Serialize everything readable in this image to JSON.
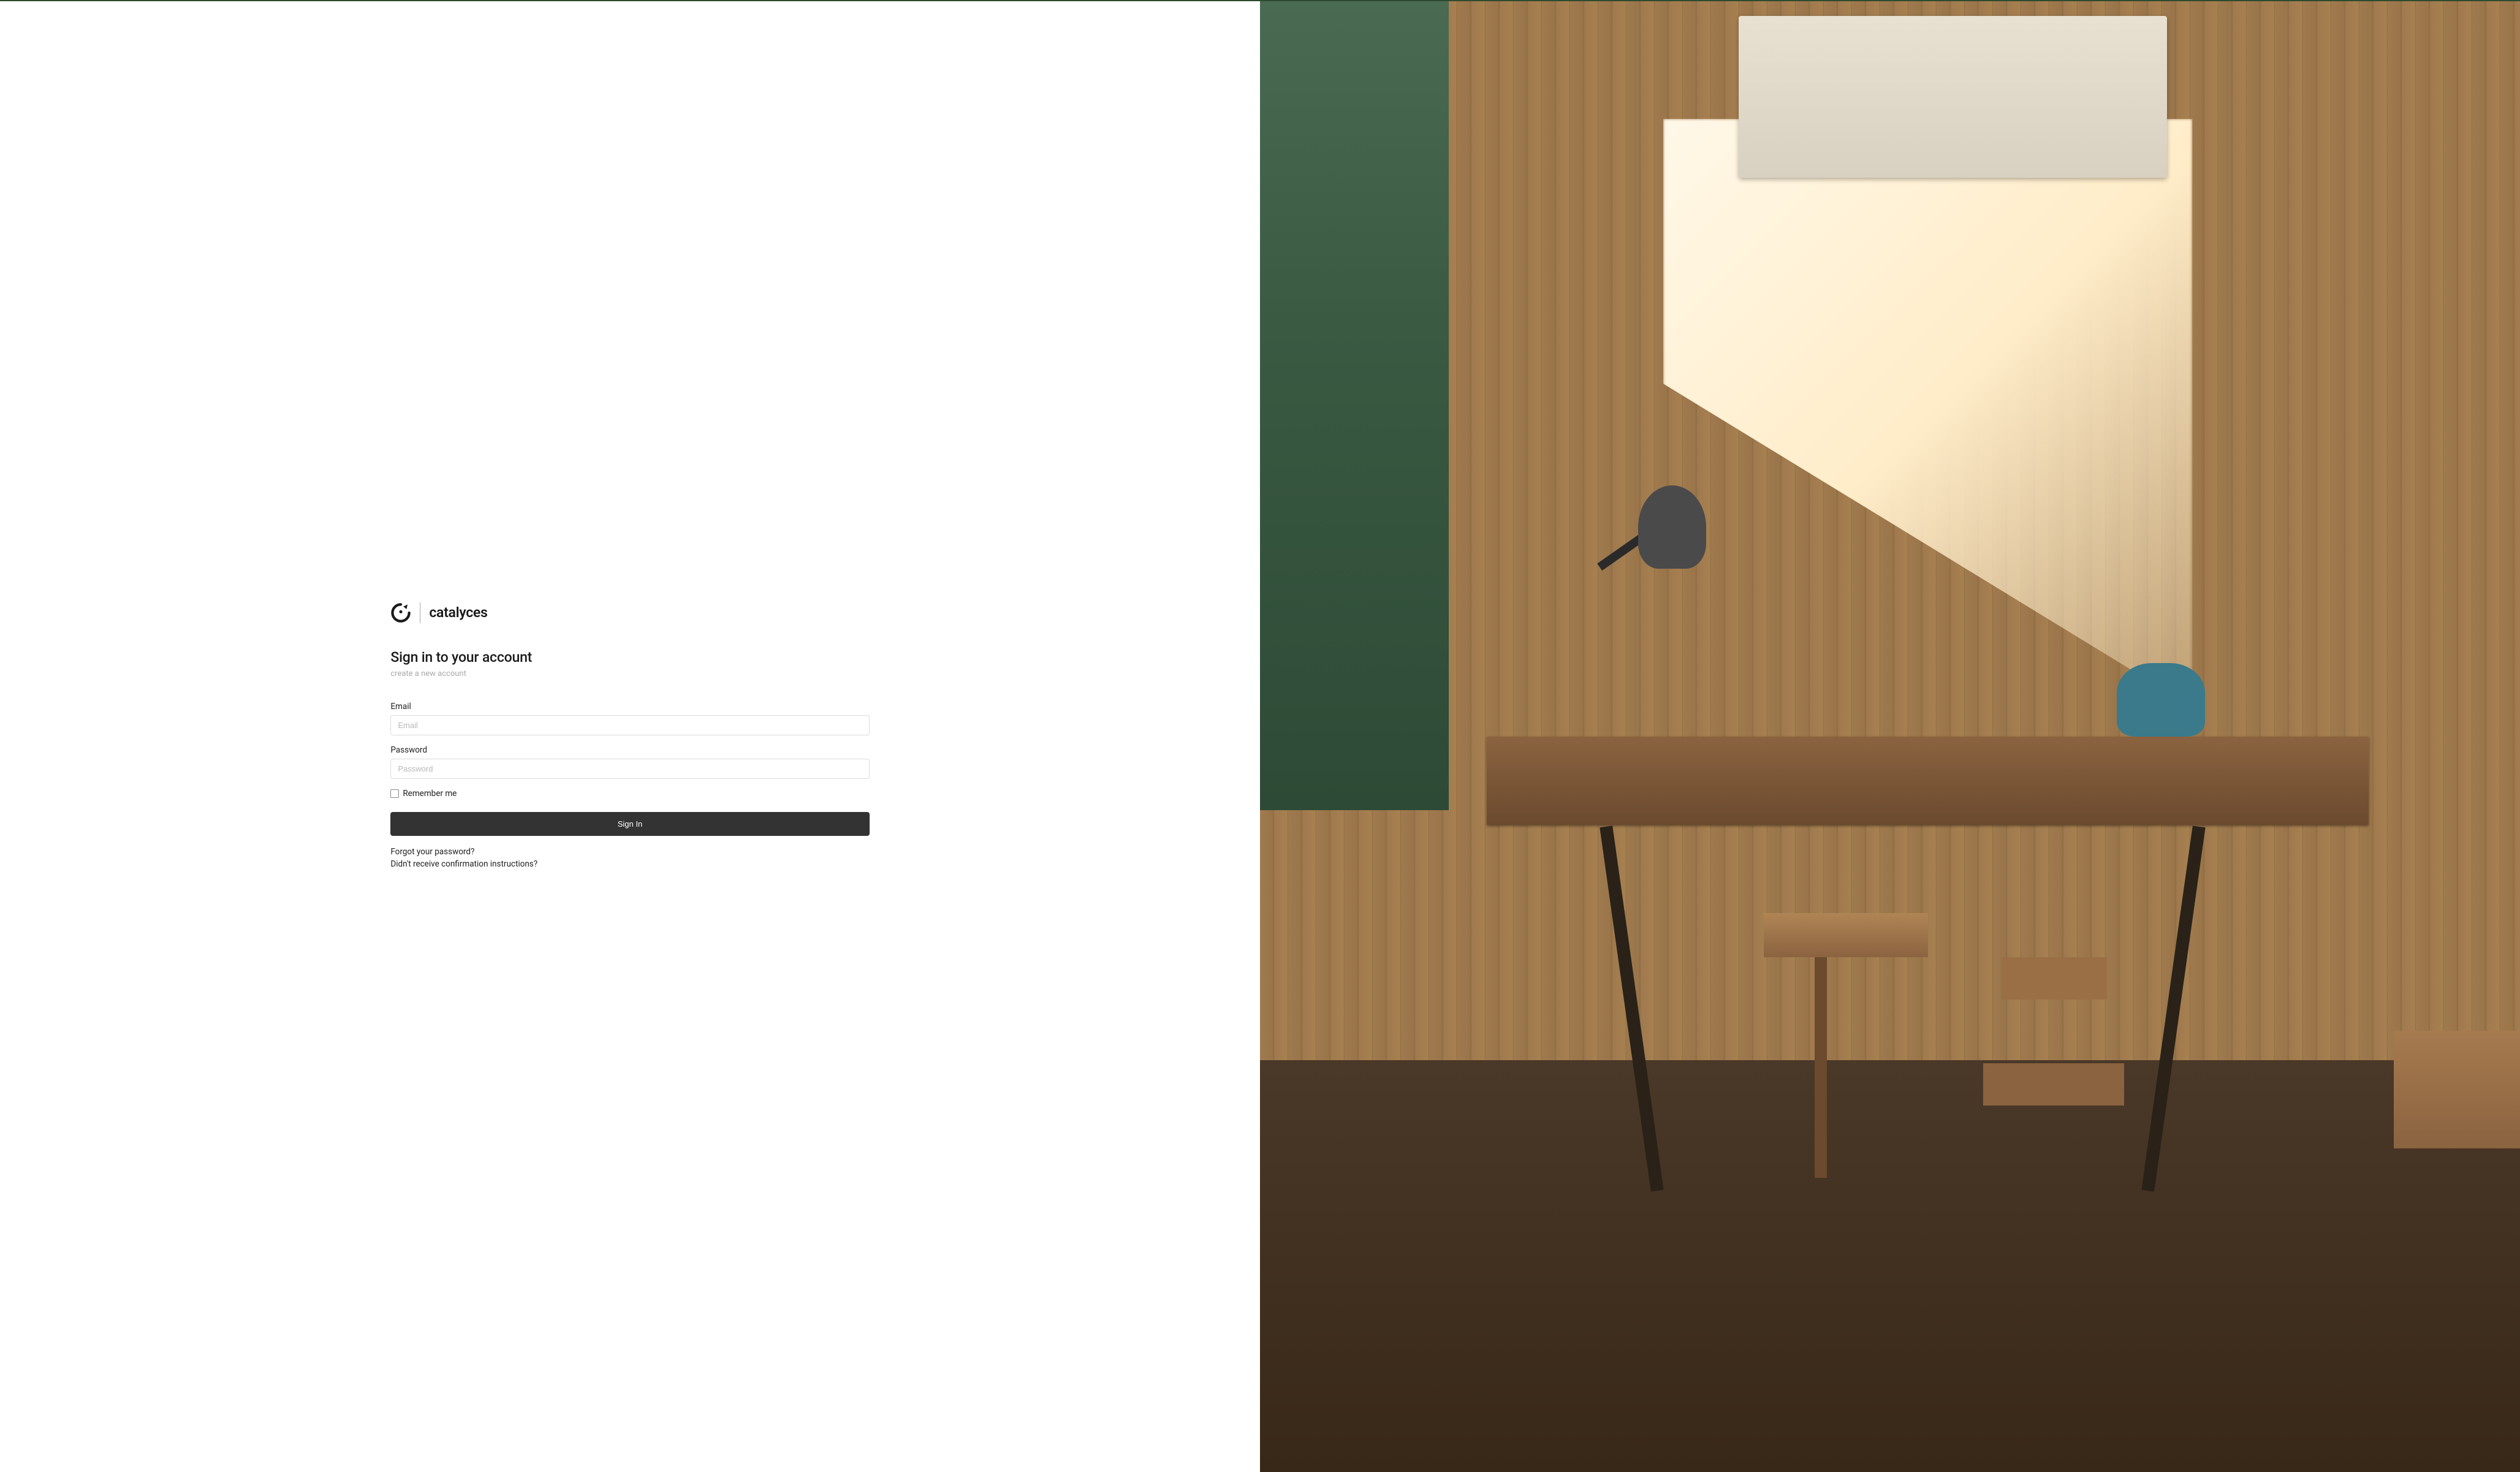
{
  "brand": {
    "name": "catalyces"
  },
  "page": {
    "heading": "Sign in to your account",
    "create_account_link": "create a new account"
  },
  "form": {
    "email": {
      "label": "Email",
      "placeholder": "Email",
      "value": ""
    },
    "password": {
      "label": "Password",
      "placeholder": "Password",
      "value": ""
    },
    "remember": {
      "label": "Remember me"
    },
    "submit_label": "Sign In"
  },
  "links": {
    "forgot_password": "Forgot your password?",
    "resend_confirmation": "Didn't receive confirmation instructions?"
  }
}
